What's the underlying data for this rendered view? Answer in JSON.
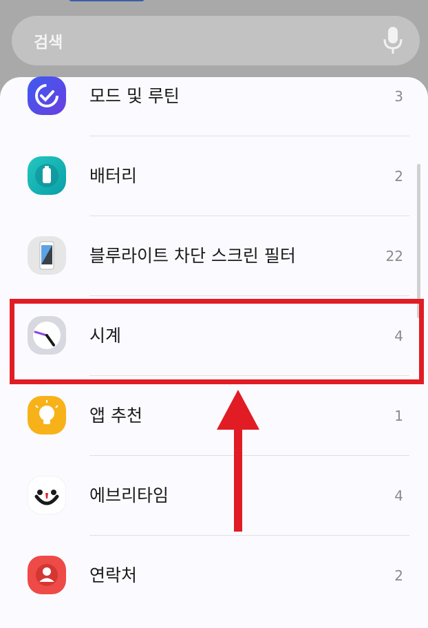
{
  "search": {
    "placeholder": "검색",
    "icon": "mic-icon"
  },
  "list": {
    "items": [
      {
        "label": "모드 및 루틴",
        "count": "3",
        "icon": "modes-routines-icon"
      },
      {
        "label": "배터리",
        "count": "2",
        "icon": "battery-icon"
      },
      {
        "label": "블루라이트 차단 스크린 필터",
        "count": "22",
        "icon": "bluelight-filter-icon"
      },
      {
        "label": "시계",
        "count": "4",
        "icon": "clock-icon"
      },
      {
        "label": "앱 추천",
        "count": "1",
        "icon": "lightbulb-icon"
      },
      {
        "label": "에브리타임",
        "count": "4",
        "icon": "everytime-icon"
      },
      {
        "label": "연락처",
        "count": "2",
        "icon": "contacts-icon"
      }
    ]
  },
  "annotation": {
    "highlight_color": "#e11c24",
    "highlighted_item": "시계"
  },
  "colors": {
    "sheet_bg": "#fbfafe",
    "backdrop": "#a9a9a9",
    "search_bg": "#c2c2c2"
  }
}
